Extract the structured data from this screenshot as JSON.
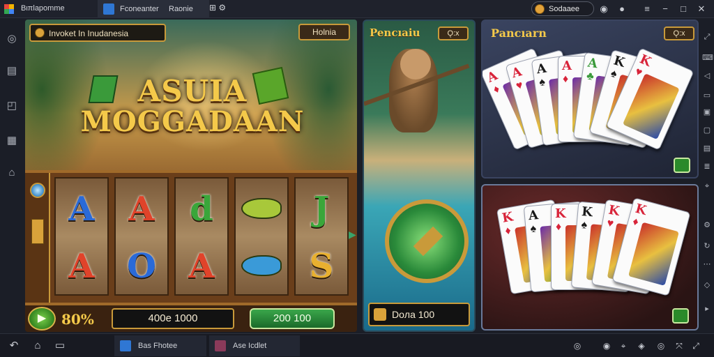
{
  "window": {
    "app_title": "Βιπlapomme",
    "tabs": [
      {
        "label": "Fconeanter"
      },
      {
        "label": "Raonie"
      }
    ],
    "coin_label": "Sodaaee"
  },
  "slot": {
    "info_banner": "Invoket In Inudanesia",
    "menu_button": "Holnia",
    "title_line1": "ASUIA",
    "title_line2": "MOGGADAAN",
    "reels": [
      [
        {
          "t": "A",
          "c": "#2a6ad8"
        },
        {
          "t": "A",
          "c": "#e0432a"
        }
      ],
      [
        {
          "t": "A",
          "c": "#e0432a"
        },
        {
          "t": "O",
          "c": "#2a6ad8"
        }
      ],
      [
        {
          "t": "d",
          "c": "#3aa63a"
        },
        {
          "t": "A",
          "c": "#e0432a"
        }
      ],
      [
        {
          "t": "fish",
          "c": "#a8c83a"
        },
        {
          "t": "fish",
          "c": "#3a9ad8"
        }
      ],
      [
        {
          "t": "J",
          "c": "#3aa63a"
        },
        {
          "t": "S",
          "c": "#e8b030"
        }
      ]
    ],
    "percent": "80%",
    "balance": "400e 1000",
    "win": "200 100"
  },
  "middle": {
    "title": "Pencıaiu",
    "badge": "Ǫ:x",
    "balance": "Doлa 100"
  },
  "right_top": {
    "title": "Pancıarn",
    "badge": "Ǫ:x",
    "cards": [
      {
        "rank": "A",
        "suit": "♦",
        "color": "#d8243a"
      },
      {
        "rank": "A",
        "suit": "♥",
        "color": "#d8243a"
      },
      {
        "rank": "A",
        "suit": "♠",
        "color": "#1a1a1a"
      },
      {
        "rank": "A",
        "suit": "♦",
        "color": "#d8243a"
      },
      {
        "rank": "A",
        "suit": "♣",
        "color": "#3a9a3a"
      },
      {
        "rank": "K",
        "suit": "♠",
        "color": "#1a1a1a"
      },
      {
        "rank": "K",
        "suit": "♥",
        "color": "#d8243a"
      }
    ]
  },
  "right_bottom": {
    "cards": [
      {
        "rank": "K",
        "suit": "♦",
        "color": "#d8243a"
      },
      {
        "rank": "A",
        "suit": "♠",
        "color": "#1a1a1a"
      },
      {
        "rank": "K",
        "suit": "♦",
        "color": "#d8243a"
      },
      {
        "rank": "K",
        "suit": "♠",
        "color": "#1a1a1a"
      },
      {
        "rank": "K",
        "suit": "♥",
        "color": "#d8243a"
      },
      {
        "rank": "K",
        "suit": "♦",
        "color": "#d8243a"
      }
    ]
  },
  "taskbar": {
    "items": [
      {
        "label": "Bas Fhotee"
      },
      {
        "label": "Ase Icdlet"
      }
    ]
  }
}
